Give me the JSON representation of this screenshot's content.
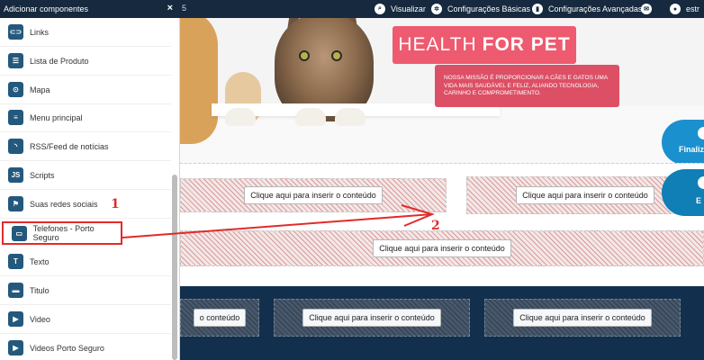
{
  "topbar": {
    "num": "5",
    "visualizar": "Visualizar",
    "config_basicas": "Configurações Básicas",
    "config_avancadas": "Configurações Avançadas",
    "user": "estr"
  },
  "sidebar": {
    "title": "Adicionar componentes",
    "close": "×",
    "items": [
      {
        "label": "Links",
        "icon": "link-icon",
        "glyph": "⊂⊃"
      },
      {
        "label": "Lista de Produto",
        "icon": "list-icon",
        "glyph": "☰"
      },
      {
        "label": "Mapa",
        "icon": "map-pin-icon",
        "glyph": "⊙"
      },
      {
        "label": "Menu principal",
        "icon": "menu-icon",
        "glyph": "≡"
      },
      {
        "label": "RSS/Feed de notícias",
        "icon": "rss-icon",
        "glyph": "◝"
      },
      {
        "label": "Scripts",
        "icon": "js-icon",
        "glyph": "JS"
      },
      {
        "label": "Suas redes sociais",
        "icon": "flag-icon",
        "glyph": "⚑"
      },
      {
        "label": "Telefones - Porto Seguro",
        "icon": "phone-screen-icon",
        "glyph": "▭"
      },
      {
        "label": "Texto",
        "icon": "text-icon",
        "glyph": "T"
      },
      {
        "label": "Titulo",
        "icon": "title-icon",
        "glyph": "▬"
      },
      {
        "label": "Video",
        "icon": "video-icon",
        "glyph": "▶"
      },
      {
        "label": "Videos Porto Seguro",
        "icon": "video-list-icon",
        "glyph": "▶"
      }
    ]
  },
  "hero": {
    "brand_light": "HEALTH",
    "brand_bold": "FOR PET",
    "mission": "NOSSA MISSÃO É PROPORCIONAR A CÃES E GATOS UMA VIDA MAIS SAUDÁVEL E FELIZ, ALIANDO TECNOLOGIA, CARINHO E COMPROMETIMENTO.",
    "cta1": "Finaliz",
    "cta2": "E"
  },
  "slots": {
    "insert_label": "Clique aqui para inserir o conteúdo",
    "partial_label": "o conteúdo"
  },
  "annotations": {
    "one": "1",
    "two": "2"
  },
  "colors": {
    "accent_red": "#e32a2a",
    "navy": "#16293e",
    "brand_pink": "#ee5a6f"
  }
}
